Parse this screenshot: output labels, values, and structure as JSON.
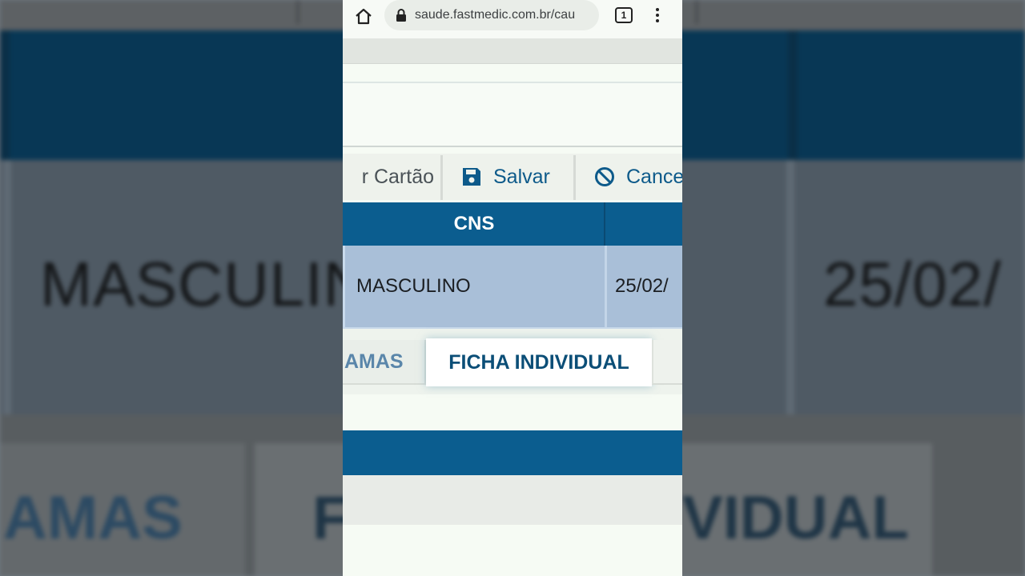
{
  "browser": {
    "url": "saude.fastmedic.com.br/cau",
    "tab_count": "1"
  },
  "toolbar": {
    "cartao_label": "r Cartão",
    "save_label": "Salvar",
    "cancel_label": "Cance"
  },
  "table": {
    "header_cns": "CNS",
    "row_sexo": "MASCULINO",
    "row_data": "25/02/"
  },
  "tabs": {
    "amas_label": "AMAS",
    "ficha_label": "FICHA INDIVIDUAL"
  },
  "background": {
    "sexo_text": "MASCULIN",
    "data_text": "25/02/",
    "amas_text": "AMAS",
    "ficha_left_text": "F",
    "ficha_right_text": "VIDUAL"
  },
  "colors": {
    "header_blue": "#0b5d8f",
    "row_blue": "#a9bfd8",
    "link_blue": "#0d5a8a"
  },
  "icons": {
    "home": "home-icon",
    "lock": "lock-icon",
    "tabs": "tabs-icon",
    "menu": "menu-icon",
    "save": "save-icon",
    "cancel": "block-icon"
  }
}
